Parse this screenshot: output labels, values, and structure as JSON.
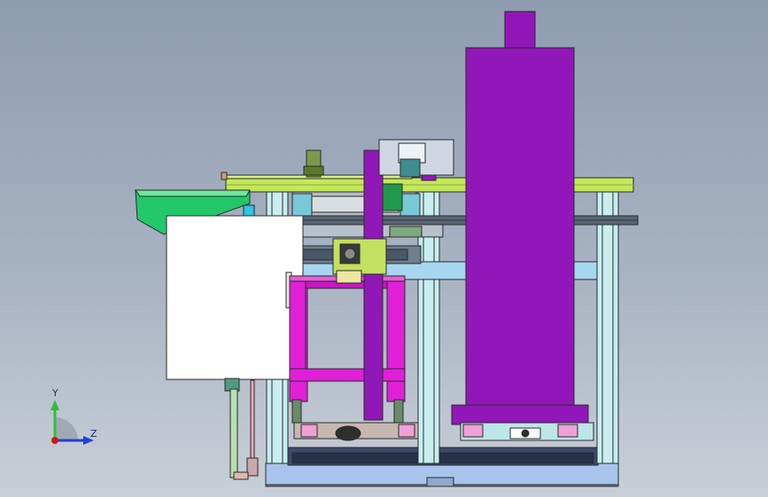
{
  "viewport": {
    "background_top": "#8e9cb0",
    "background_bottom": "#c9cfd8"
  },
  "triad": {
    "y_label": "Y",
    "z_label": "Z",
    "y_color": "#2fbf3a",
    "z_color": "#1f3fd8",
    "origin_color": "#d01818"
  },
  "model": {
    "colors": {
      "purple_column": "#9217b8",
      "magenta_frame": "#e020d8",
      "yellow_green_plate": "#c4e85a",
      "green_hopper": "#22c86a",
      "light_blue_base": "#a8c4ec",
      "cyan_profile": "#c8eef0",
      "steel": "#9aa3ad",
      "dark_outline": "#2a2a2a"
    }
  }
}
